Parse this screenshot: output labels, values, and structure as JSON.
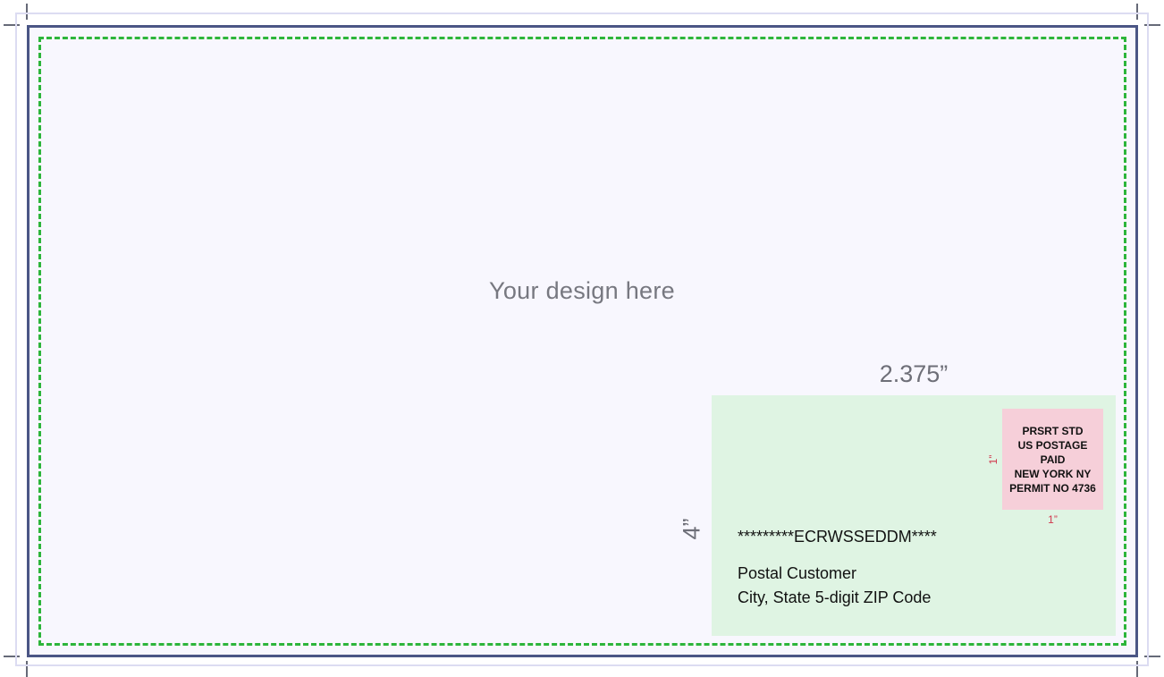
{
  "canvas": {
    "design_placeholder": "Your design here"
  },
  "dimensions": {
    "address_zone_width": "2.375”",
    "address_zone_height": "4”",
    "indicia_height": "1”",
    "indicia_width": "1”"
  },
  "indicia": {
    "lines": [
      "PRSRT STD",
      "US POSTAGE",
      "PAID",
      "NEW YORK NY",
      "PERMIT NO 4736"
    ]
  },
  "address": {
    "barcode_line": "*********ECRWSSEDDM****",
    "recipient": "Postal Customer",
    "city_line": "City, State 5-digit ZIP Code"
  },
  "colors": {
    "trim": "#4b5685",
    "bleed": "#dcdcf2",
    "safety": "#2db53b",
    "address_zone": "#dff4e3",
    "indicia": "#f6cfd9",
    "dimension_accent": "#d0364c"
  }
}
